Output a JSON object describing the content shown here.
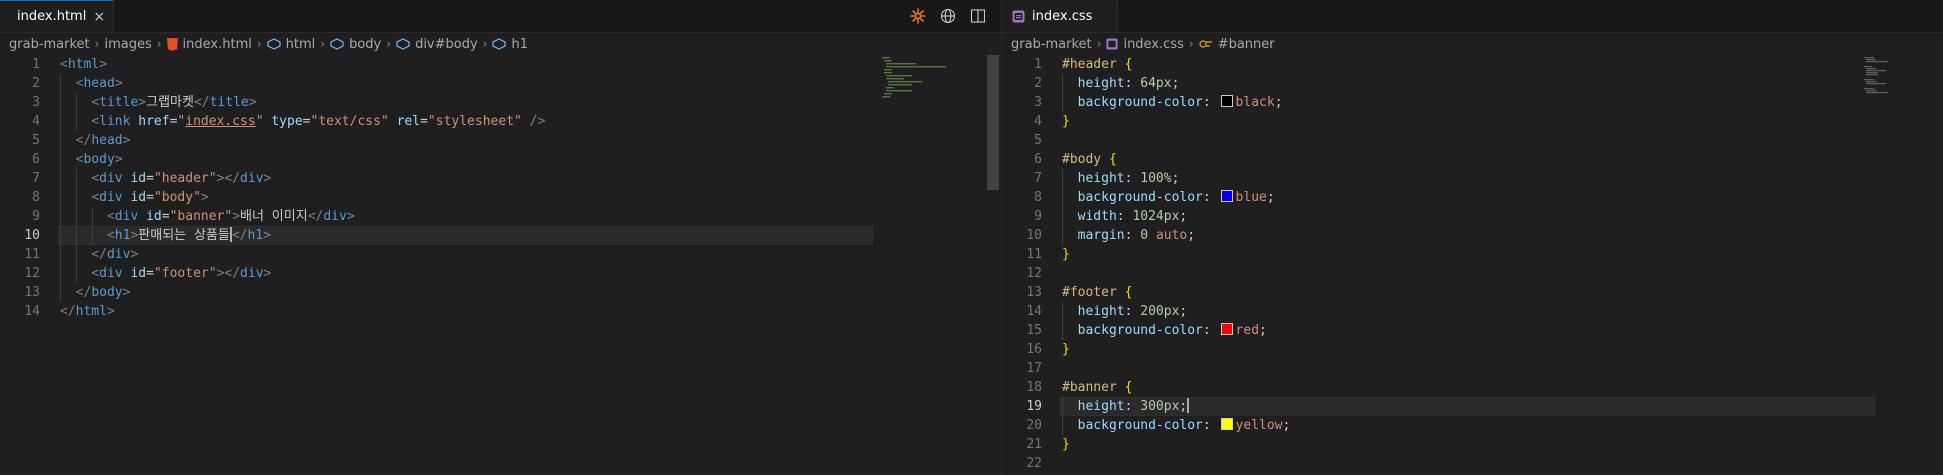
{
  "left": {
    "tab": {
      "label": "index.html",
      "close": "×"
    },
    "actions": {
      "sparkle_icon": "sparkle-icon",
      "globe_icon": "globe-icon",
      "split_icon": "split-editor-icon"
    },
    "breadcrumb": [
      "grab-market",
      "images",
      "index.html",
      "html",
      "body",
      "div#body",
      "h1"
    ],
    "active_line": 10,
    "lines": [
      {
        "n": 1,
        "indent": 0
      },
      {
        "n": 2,
        "indent": 1
      },
      {
        "n": 3,
        "indent": 2
      },
      {
        "n": 4,
        "indent": 2
      },
      {
        "n": 5,
        "indent": 1
      },
      {
        "n": 6,
        "indent": 1
      },
      {
        "n": 7,
        "indent": 2
      },
      {
        "n": 8,
        "indent": 2
      },
      {
        "n": 9,
        "indent": 3
      },
      {
        "n": 10,
        "indent": 3
      },
      {
        "n": 11,
        "indent": 2
      },
      {
        "n": 12,
        "indent": 2
      },
      {
        "n": 13,
        "indent": 1
      },
      {
        "n": 14,
        "indent": 0
      }
    ],
    "code": {
      "l1_tag": "html",
      "l2_tag": "head",
      "l3_tag": "title",
      "l3_text": "그랩마켓",
      "l3_close": "title",
      "l4_tag": "link",
      "l4_attr1": "href",
      "l4_val1": "index.css",
      "l4_attr2": "type",
      "l4_val2": "\"text/css\"",
      "l4_attr3": "rel",
      "l4_val3": "\"stylesheet\"",
      "l5_tag": "head",
      "l6_tag": "body",
      "l7_tag": "div",
      "l7_attr": "id",
      "l7_val": "\"header\"",
      "l7_close": "div",
      "l8_tag": "div",
      "l8_attr": "id",
      "l8_val": "\"body\"",
      "l9_tag": "div",
      "l9_attr": "id",
      "l9_val": "\"banner\"",
      "l9_text": "배너 이미지",
      "l9_close": "div",
      "l10_tag": "h1",
      "l10_text": "판매되는 상품들",
      "l10_close": "h1",
      "l11_tag": "div",
      "l12_tag": "div",
      "l12_attr": "id",
      "l12_val": "\"footer\"",
      "l12_close": "div",
      "l13_tag": "body",
      "l14_tag": "html"
    }
  },
  "right": {
    "tab": {
      "label": "index.css"
    },
    "breadcrumb": [
      "grab-market",
      "index.css",
      "#banner"
    ],
    "active_line": 19,
    "line_numbers": [
      1,
      2,
      3,
      4,
      5,
      6,
      7,
      8,
      9,
      10,
      11,
      12,
      13,
      14,
      15,
      16,
      17,
      18,
      19,
      20,
      21,
      22
    ],
    "colors": {
      "black": "#000000",
      "blue": "#0000ff",
      "red": "#ff0000",
      "yellow": "#ffff00"
    },
    "code": {
      "s1": "#header",
      "p1a": "height",
      "v1a": "64px",
      "p1b": "background-color",
      "v1b": "black",
      "s2": "#body",
      "p2a": "height",
      "v2a": "100%",
      "p2b": "background-color",
      "v2b": "blue",
      "p2c": "width",
      "v2c": "1024px",
      "p2d": "margin",
      "v2d_num": "0",
      "v2d_kw": "auto",
      "s3": "#footer",
      "p3a": "height",
      "v3a": "200px",
      "p3b": "background-color",
      "v3b": "red",
      "s4": "#banner",
      "p4a": "height",
      "v4a": "300px",
      "p4b": "background-color",
      "v4b": "yellow"
    }
  }
}
